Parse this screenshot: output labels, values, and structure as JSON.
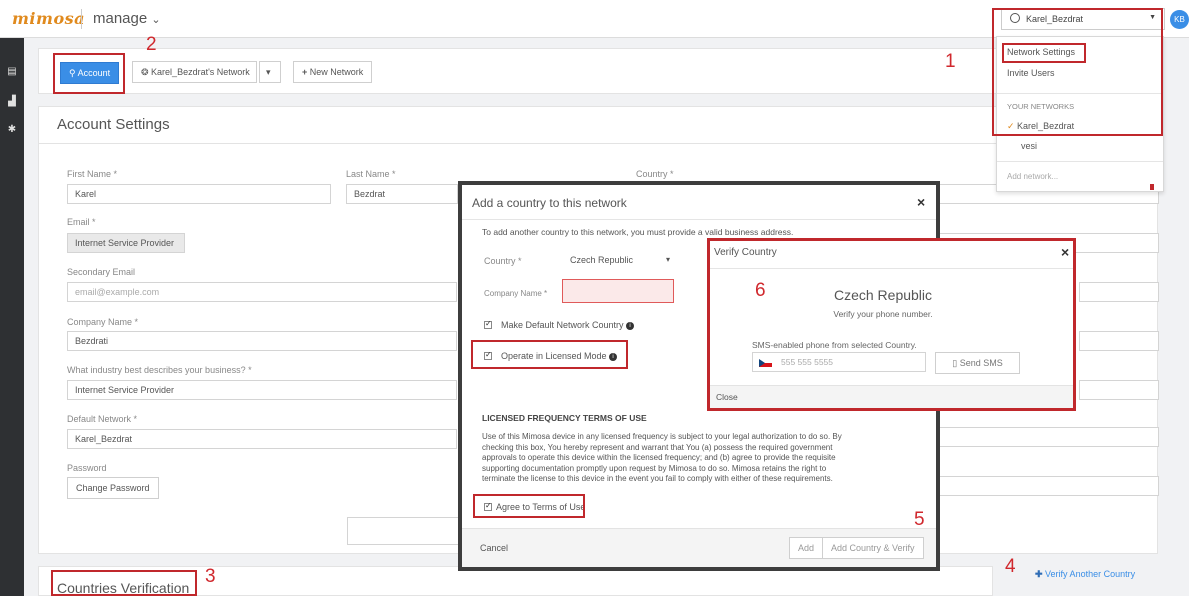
{
  "header": {
    "logo": "mimosa",
    "app_name": "manage",
    "app_caret": "⌄",
    "user_chip": "Karel_Bezdrat",
    "avatar": "KB"
  },
  "dropdown": {
    "network_settings": "Network Settings",
    "invite_users": "Invite Users",
    "your_networks": "YOUR NETWORKS",
    "selected_network": "Karel_Bezdrat",
    "other_network": "vesi",
    "add_network": "Add network..."
  },
  "toolbar": {
    "account": "Account",
    "network": "Karel_Bezdrat's Network",
    "network_caret": "▾",
    "new_network": "New Network"
  },
  "steps": {
    "s1": "1",
    "s2": "2",
    "s3": "3",
    "s4": "4",
    "s5": "5",
    "s6": "6"
  },
  "account_settings": {
    "title": "Account Settings",
    "first_name_label": "First Name *",
    "first_name": "Karel",
    "last_name_label": "Last Name *",
    "last_name": "Bezdrat",
    "country_label": "Country *",
    "email_label": "Email *",
    "email_value": "Internet Service Provider",
    "secondary_email_label": "Secondary Email",
    "secondary_email_placeholder": "email@example.com",
    "company_label": "Company Name *",
    "company_value": "Bezdrati",
    "industry_label": "What industry best describes your business? *",
    "industry_value": "Internet Service Provider",
    "default_network_label": "Default Network *",
    "default_network_value": "Karel_Bezdrat",
    "password_label": "Password",
    "change_password": "Change Password"
  },
  "countries": {
    "title": "Countries Verification",
    "verify_another": "Verify Another Country"
  },
  "add_country_modal": {
    "title": "Add a country to this network",
    "close": "×",
    "intro": "To add another country to this network, you must provide a valid business address.",
    "country_label": "Country *",
    "country_value": "Czech Republic",
    "country_caret": "▾",
    "company_label": "Company Name *",
    "make_default": "Make Default Network Country",
    "licensed_mode": "Operate in Licensed Mode",
    "terms_title": "LICENSED FREQUENCY TERMS OF USE",
    "terms_line1": "Use of this Mimosa device in any licensed frequency is subject to your legal authorization to do so. By",
    "terms_line2": "checking this box, You hereby represent and warrant that You (a) possess the required government",
    "terms_line3": "approvals to operate this device within the licensed frequency; and (b) agree to provide the requisite",
    "terms_line4": "supporting documentation promptly upon request by Mimosa to do so. Mimosa retains the right to",
    "terms_line5": "terminate the license to this device in the event you fail to comply with either of these requirements.",
    "agree": "Agree to Terms of Use",
    "cancel": "Cancel",
    "add": "Add",
    "add_verify": "Add Country & Verify"
  },
  "verify_modal": {
    "title": "Verify Country",
    "close": "×",
    "country": "Czech Republic",
    "subtitle": "Verify your phone number.",
    "sms_label": "SMS-enabled phone from selected Country.",
    "phone_placeholder": "555 555 5555",
    "send_sms": "Send SMS",
    "close_link": "Close"
  },
  "colors": {
    "accent": "#3a8ee6",
    "annotation_red": "#c0282c",
    "logo_orange": "#e08a1e",
    "rail": "#2e3033"
  },
  "icons": [
    "grid-icon",
    "bar-chart-icon",
    "gear-icon",
    "user-icon",
    "globe-icon",
    "plus-icon",
    "info-icon",
    "phone-icon",
    "flag-icon",
    "check-icon"
  ]
}
